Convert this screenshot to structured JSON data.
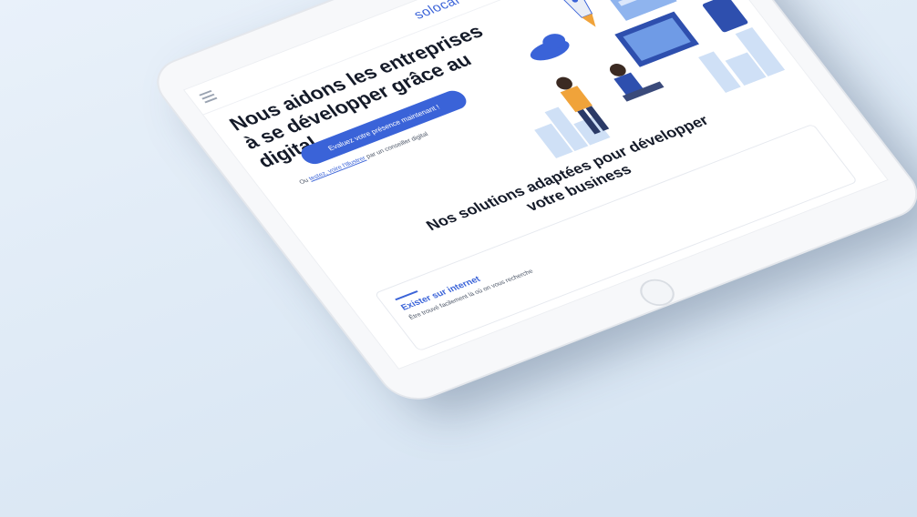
{
  "header": {
    "logo": "solocal",
    "menu_icon": "menu-icon",
    "phone_icon": "phone-icon",
    "user_icon": "user-icon"
  },
  "hero": {
    "title": "Nous aidons les entreprises à se développer grâce au digital",
    "cta_label": "Evaluez votre présence maintenant !",
    "sub_prefix": "Ou",
    "sub_link": "testez, voire l'Illustrer",
    "sub_suffix": "par un conseiller digital"
  },
  "solutions": {
    "title": "Nos solutions adaptées pour développer votre business",
    "card_title": "Exister sur internet",
    "card_text": "Être trouvé facilement là où on vous recherche"
  },
  "colors": {
    "accent": "#3a63d8",
    "pager_active": "#e2584a"
  }
}
